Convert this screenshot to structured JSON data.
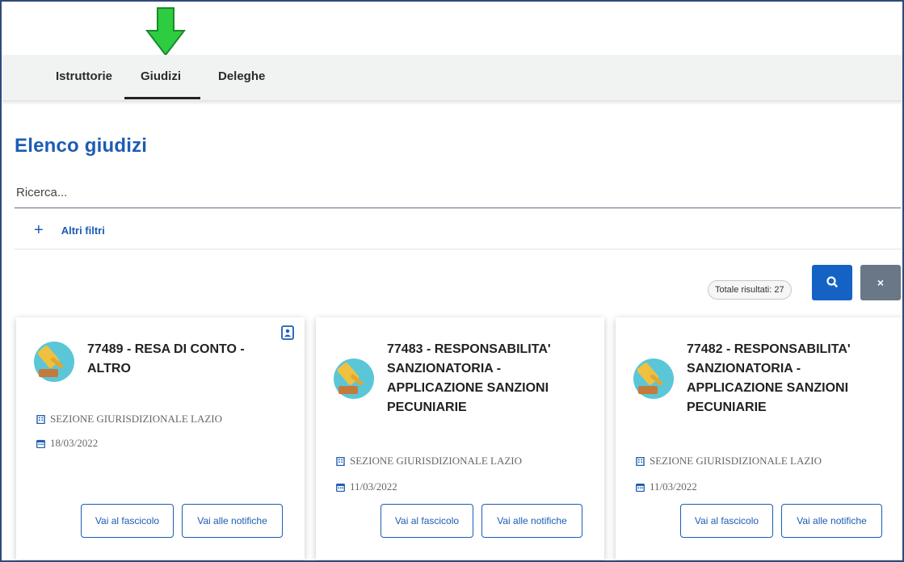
{
  "tabs": [
    {
      "label": "Istruttorie"
    },
    {
      "label": "Giudizi"
    },
    {
      "label": "Deleghe"
    }
  ],
  "page_title": "Elenco giudizi",
  "search": {
    "placeholder": "Ricerca...",
    "value": ""
  },
  "filters": {
    "label": "Altri filtri"
  },
  "results": {
    "label": "Totale risultati: 27"
  },
  "buttons": {
    "clear_label": "×"
  },
  "cards": [
    {
      "title": "77489 - RESA DI CONTO - ALTRO",
      "section": "SEZIONE GIURISDIZIONALE LAZIO",
      "date": "18/03/2022",
      "btn_fascicolo": "Vai al fascicolo",
      "btn_notifiche": "Vai alle notifiche"
    },
    {
      "title": "77483 - RESPONSABILITA' SANZIONATORIA - APPLICAZIONE SANZIONI PECUNIARIE",
      "section": "SEZIONE GIURISDIZIONALE LAZIO",
      "date": "11/03/2022",
      "btn_fascicolo": "Vai al fascicolo",
      "btn_notifiche": "Vai alle notifiche"
    },
    {
      "title": "77482 - RESPONSABILITA' SANZIONATORIA - APPLICAZIONE SANZIONI PECUNIARIE",
      "section": "SEZIONE GIURISDIZIONALE LAZIO",
      "date": "11/03/2022",
      "btn_fascicolo": "Vai al fascicolo",
      "btn_notifiche": "Vai alle notifiche"
    }
  ],
  "colors": {
    "primary": "#1c5cb4",
    "search_button": "#1462c4",
    "clear_button": "#697787",
    "arrow": "#2ecc40"
  },
  "icons": [
    "arrow-down-icon",
    "plus-icon",
    "search-icon",
    "close-icon",
    "contact-card-icon",
    "gavel-icon",
    "building-icon",
    "calendar-icon"
  ]
}
